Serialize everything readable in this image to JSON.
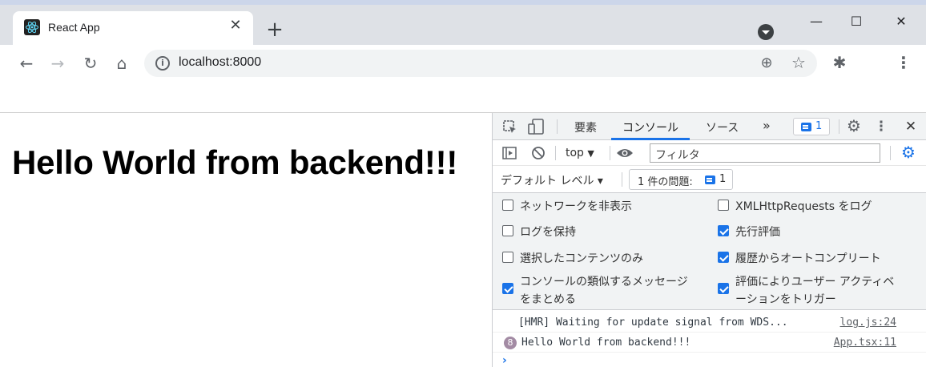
{
  "browser": {
    "tab_title": "React App",
    "tab_close": "✕",
    "new_tab": "+",
    "url": "localhost:8000",
    "window_controls": {
      "minimize": "—",
      "maximize": "☐",
      "close": "✕"
    }
  },
  "page": {
    "heading": "Hello World from backend!!!"
  },
  "devtools": {
    "tabs": [
      {
        "label": "要素"
      },
      {
        "label": "コンソール",
        "active": true
      },
      {
        "label": "ソース"
      }
    ],
    "more_tabs": "»",
    "issue_count": "1",
    "context": "top",
    "filter_placeholder": "フィルタ",
    "default_levels": "デフォルト レベル ▾",
    "issues_label": "1 件の問題:",
    "issues_count": "1",
    "settings": [
      {
        "label": "ネットワークを非表示",
        "checked": false
      },
      {
        "label": "XMLHttpRequests をログ",
        "checked": false
      },
      {
        "label": "ログを保持",
        "checked": false
      },
      {
        "label": "先行評価",
        "checked": true
      },
      {
        "label": "選択したコンテンツのみ",
        "checked": false
      },
      {
        "label": "履歴からオートコンプリート",
        "checked": true
      },
      {
        "label_1": "コンソールの類似するメッセージ",
        "label_2": "をまとめる",
        "checked": true
      },
      {
        "label_1": "評価によりユーザー アクティベ",
        "label_2": "ーションをトリガー",
        "checked": true
      }
    ],
    "console": [
      {
        "text": "[HMR] Waiting for update signal from WDS...",
        "source": "log.js:24"
      },
      {
        "count": "8",
        "text": "Hello World from backend!!!",
        "source": "App.tsx:11"
      }
    ],
    "prompt": "›"
  },
  "colors": {
    "accent": "#1a73e8",
    "chrome_bg": "#dee1e6",
    "devtools_bar": "#f1f3f4"
  }
}
